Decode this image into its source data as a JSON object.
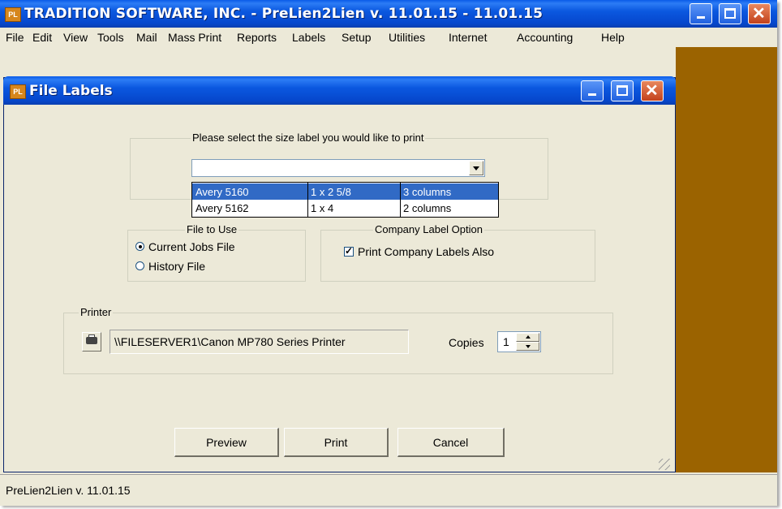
{
  "app": {
    "title": "TRADITION SOFTWARE, INC. - PreLien2Lien v. 11.01.15 - 11.01.15",
    "icon_text": "PL"
  },
  "menu": [
    "File",
    "Edit",
    "View",
    "Tools",
    "Mail",
    "Mass Print",
    "Reports",
    "Labels",
    "Setup",
    "Utilities",
    "Internet",
    "Accounting",
    "Help"
  ],
  "dialog": {
    "title": "File Labels",
    "icon_text": "PL",
    "size_group_label": "Please select the size label you would like to print",
    "size_combo_value": "",
    "size_options": [
      {
        "name": "Avery 5160",
        "size": "1 x 2 5/8",
        "columns": "3 columns",
        "selected": true
      },
      {
        "name": "Avery 5162",
        "size": "1 x 4",
        "columns": "2 columns",
        "selected": false
      }
    ],
    "file_group_label": "File to Use",
    "file_options": [
      {
        "label": "Current Jobs File",
        "checked": true
      },
      {
        "label": "History File",
        "checked": false
      }
    ],
    "company_group_label": "Company Label Option",
    "company_checkbox_label": "Print Company Labels Also",
    "company_checkbox_checked": true,
    "printer_group_label": "Printer",
    "printer_name": "\\\\FILESERVER1\\Canon MP780 Series Printer",
    "copies_label": "Copies",
    "copies_value": "1",
    "buttons": {
      "preview": "Preview",
      "print": "Print",
      "cancel": "Cancel"
    }
  },
  "status": {
    "text": "PreLien2Lien v. 11.01.15"
  },
  "colors": {
    "titlebar": "#0A53E0",
    "workspace": "#9B6300",
    "selection": "#316AC5",
    "dialog_bg": "#ECE9D8"
  },
  "icons": [
    "app-logo-icon",
    "minimize-icon",
    "maximize-icon",
    "close-icon",
    "dropdown-arrow-icon",
    "printer-icon",
    "spin-up-icon",
    "spin-down-icon",
    "resize-grip-icon"
  ]
}
